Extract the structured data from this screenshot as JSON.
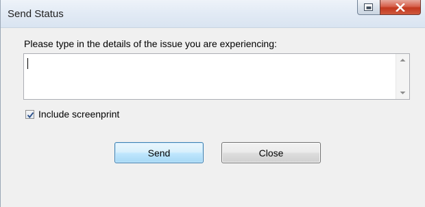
{
  "window": {
    "title": "Send Status",
    "controls": {
      "restore_icon": "restore-window-icon",
      "close_icon": "close-x-icon"
    }
  },
  "form": {
    "prompt_label": "Please type in the details of the issue you are experiencing:",
    "issue_text": {
      "value": "",
      "placeholder": ""
    },
    "include_screenprint": {
      "label": "Include screenprint",
      "checked": true
    }
  },
  "buttons": {
    "send_label": "Send",
    "close_label": "Close"
  },
  "colors": {
    "close_button_red": "#c2381f",
    "default_button_blue": "#3c7fb1",
    "dialog_background": "#f0f0f0"
  }
}
